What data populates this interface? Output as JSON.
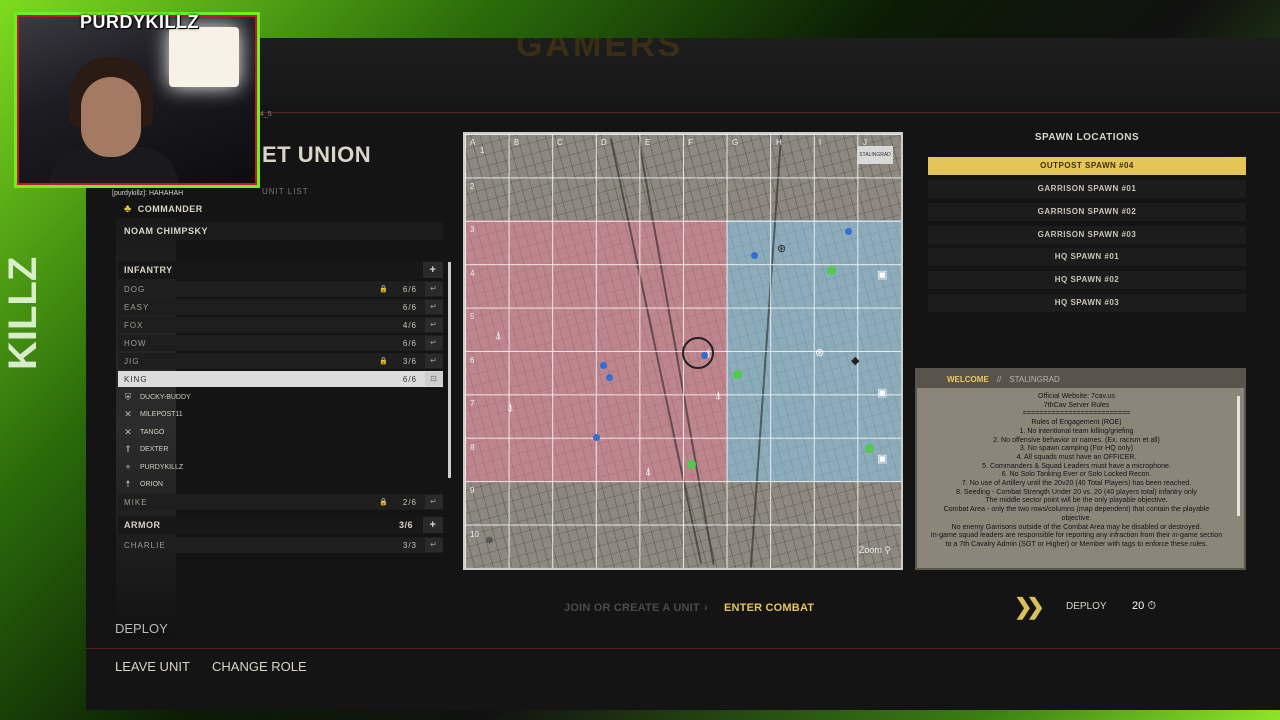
{
  "stream": {
    "streamer_name": "PURDYKILLZ",
    "side_text": "KILLZ",
    "chat_line": "[purdykillz]: HAHAHAH"
  },
  "header": {
    "faction": "ET UNION",
    "unit_list_label": "UNIT LIST",
    "tag": "4_5",
    "banner": "GAMERS"
  },
  "commander": {
    "label": "COMMANDER",
    "name": "NOAM CHIMPSKY"
  },
  "infantry": {
    "label": "INFANTRY",
    "squads": [
      {
        "name": "DOG",
        "count": "6/6",
        "locked": true
      },
      {
        "name": "EASY",
        "count": "6/6",
        "locked": false
      },
      {
        "name": "FOX",
        "count": "4/6",
        "locked": false
      },
      {
        "name": "HOW",
        "count": "6/6",
        "locked": false
      },
      {
        "name": "JIG",
        "count": "3/6",
        "locked": true
      },
      {
        "name": "KING",
        "count": "6/6",
        "locked": false
      }
    ],
    "members": [
      {
        "name": "DUCKY-BUDDY",
        "icon": "medic-icon"
      },
      {
        "name": "MILEPOST11",
        "icon": "crossed-rifles-icon"
      },
      {
        "name": "TANGO",
        "icon": "crossed-rifles-icon"
      },
      {
        "name": "DEXTER",
        "icon": "rank-chevron-icon"
      },
      {
        "name": "PURDYKILLZ",
        "icon": "cross-icon"
      },
      {
        "name": "ORION",
        "icon": "soldier-icon"
      }
    ],
    "extra_squad": {
      "name": "MIKE",
      "count": "2/6"
    }
  },
  "armor": {
    "label": "ARMOR",
    "count": "3/6",
    "squads": [
      {
        "name": "CHARLIE",
        "count": "3/3"
      }
    ]
  },
  "map": {
    "columns": [
      "A",
      "B",
      "C",
      "D",
      "E",
      "F",
      "G",
      "H",
      "I",
      "J"
    ],
    "rows": [
      "1",
      "2",
      "3",
      "4",
      "5",
      "6",
      "7",
      "8",
      "9",
      "10"
    ],
    "zoom_label": "Zoom",
    "map_badge": "STALINGRAD",
    "colors": {
      "allied_zone": "#e68296",
      "enemy_zone": "#8cc8eb"
    }
  },
  "spawns": {
    "title": "SPAWN LOCATIONS",
    "items": [
      "OUTPOST SPAWN #04",
      "GARRISON SPAWN #01",
      "GARRISON SPAWN #02",
      "GARRISON SPAWN #03",
      "HQ SPAWN #01",
      "HQ SPAWN #02",
      "HQ SPAWN #03"
    ],
    "selected_index": 0
  },
  "welcome": {
    "tab_active": "WELCOME",
    "tab_other": "STALINGRAD",
    "lines": [
      "Official Website: 7cav.us",
      "7thCav Server Rules",
      "==========================",
      "Rules of Engagement (ROE)",
      "1. No intentional team killing/griefing",
      "2. No offensive behavior or names. (Ex. racism et all)",
      "3. No spawn camping (For HQ only)",
      "4. All squads must have an OFFICER.",
      "5. Commanders & Squad Leaders must have a microphone.",
      "6. No Solo Tanking Ever or Solo Locked Recon.",
      "7. No use of Artillery until the 20v20 (40 Total Players) has been reached.",
      "8. Seeding - Combat Strength Under 20 vs. 20 (40 players total) infantry only",
      "The middle sector point will be the only playable objective.",
      "Combat Area - only the two rows/columns (map dependent) that contain the playable objective.",
      "No enemy Garrisons outside of the Combat Area may be disabled or destroyed.",
      "In-game squad leaders are responsible for reporting any infraction from their in-game section to a 7th Cavalry Admin (SGT or Higher) or Member with tags to enforce these rules."
    ]
  },
  "footer": {
    "step1": "JOIN OR CREATE A UNIT",
    "step2": "ENTER COMBAT",
    "deploy_label": "DEPLOY",
    "deploy_timer": "20",
    "deploy_section": "DEPLOY",
    "leave_unit": "LEAVE UNIT",
    "change_role": "CHANGE ROLE"
  }
}
